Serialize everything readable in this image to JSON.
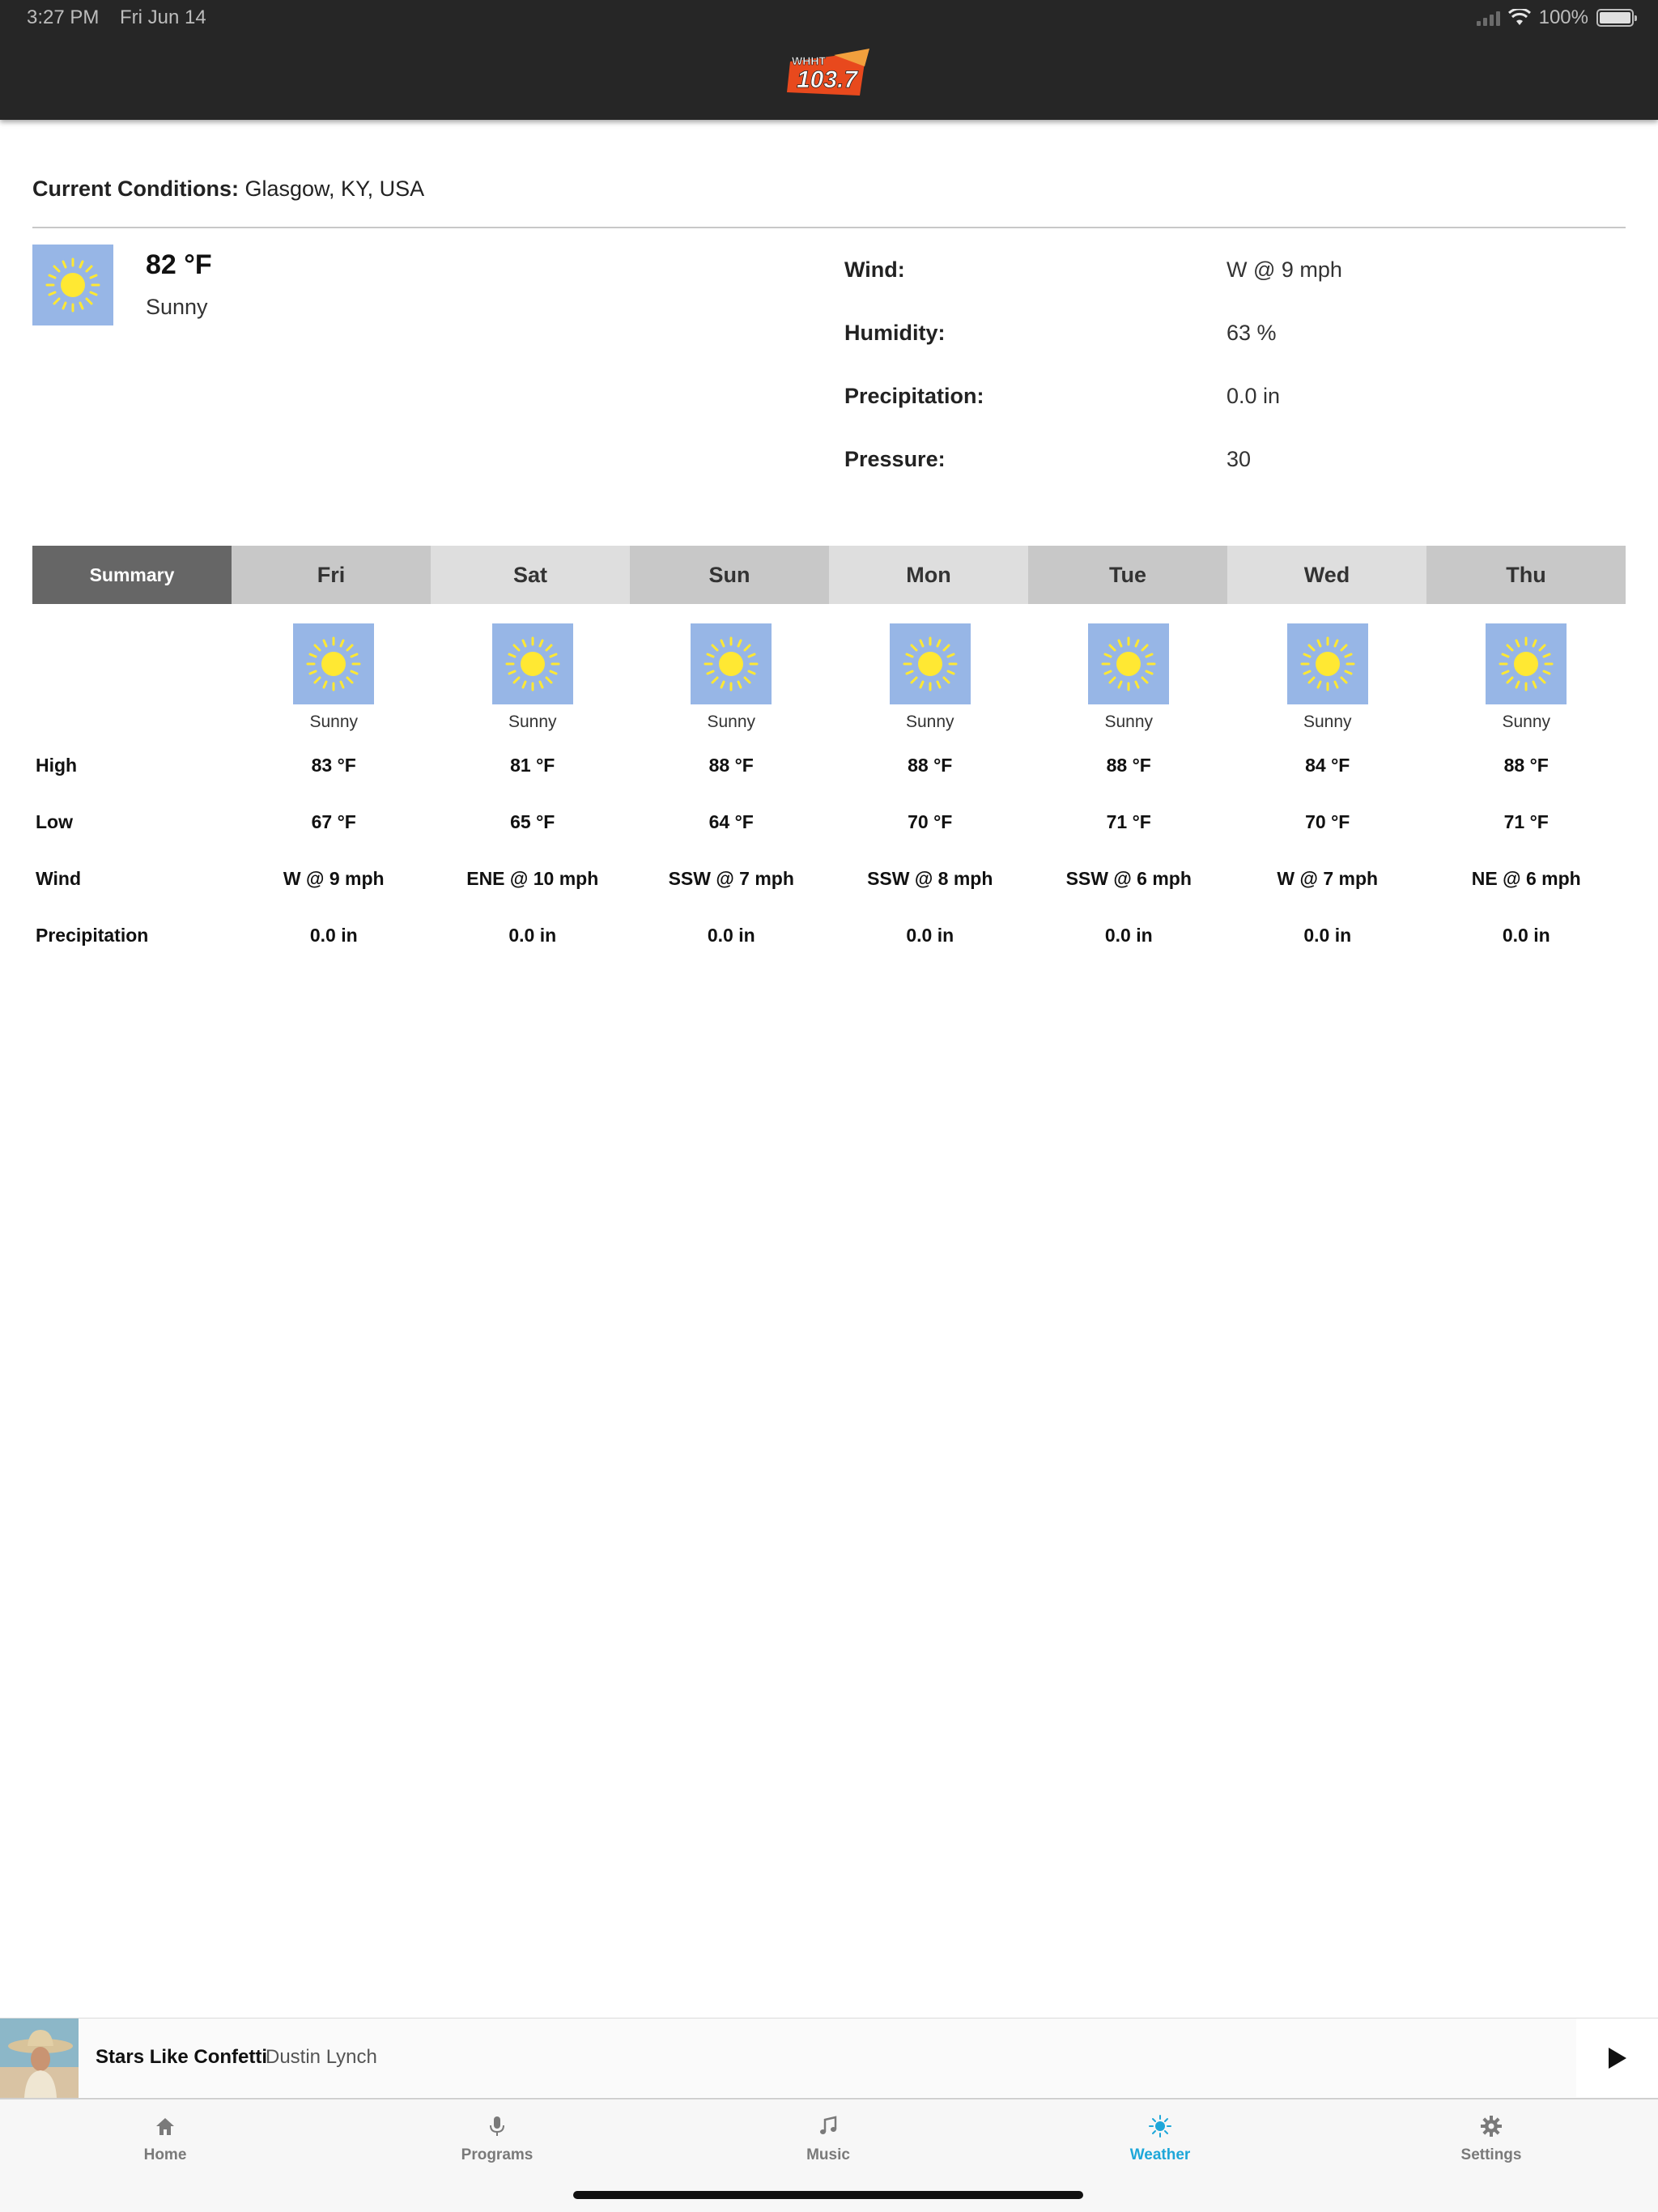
{
  "status_bar": {
    "time": "3:27 PM",
    "date": "Fri Jun 14",
    "battery": "100%"
  },
  "header": {
    "logo_top": "WHHT",
    "logo_main": "103.7"
  },
  "current": {
    "title_label": "Current Conditions:",
    "location": "Glasgow, KY, USA",
    "temp": "82 °F",
    "condition": "Sunny",
    "icon": "sun-icon",
    "details": [
      {
        "label": "Wind:",
        "value": "W @ 9 mph"
      },
      {
        "label": "Humidity:",
        "value": "63 %"
      },
      {
        "label": "Precipitation:",
        "value": "0.0 in"
      },
      {
        "label": "Pressure:",
        "value": "30"
      }
    ]
  },
  "forecast": {
    "summary_tab": "Summary",
    "days": [
      {
        "day": "Fri",
        "condition": "Sunny",
        "high": "83 °F",
        "low": "67 °F",
        "wind": "W @ 9 mph",
        "precip": "0.0 in"
      },
      {
        "day": "Sat",
        "condition": "Sunny",
        "high": "81 °F",
        "low": "65 °F",
        "wind": "ENE @ 10 mph",
        "precip": "0.0 in"
      },
      {
        "day": "Sun",
        "condition": "Sunny",
        "high": "88 °F",
        "low": "64 °F",
        "wind": "SSW @ 7 mph",
        "precip": "0.0 in"
      },
      {
        "day": "Mon",
        "condition": "Sunny",
        "high": "88 °F",
        "low": "70 °F",
        "wind": "SSW @ 8 mph",
        "precip": "0.0 in"
      },
      {
        "day": "Tue",
        "condition": "Sunny",
        "high": "88 °F",
        "low": "71 °F",
        "wind": "SSW @ 6 mph",
        "precip": "0.0 in"
      },
      {
        "day": "Wed",
        "condition": "Sunny",
        "high": "84 °F",
        "low": "70 °F",
        "wind": "W @ 7 mph",
        "precip": "0.0 in"
      },
      {
        "day": "Thu",
        "condition": "Sunny",
        "high": "88 °F",
        "low": "71 °F",
        "wind": "NE @ 6 mph",
        "precip": "0.0 in"
      }
    ],
    "row_labels": {
      "high": "High",
      "low": "Low",
      "wind": "Wind",
      "precip": "Precipitation"
    }
  },
  "now_playing": {
    "title": "Stars Like Confetti",
    "artist": "Dustin Lynch"
  },
  "tab_bar": {
    "items": [
      {
        "label": "Home",
        "icon": "home-icon"
      },
      {
        "label": "Programs",
        "icon": "microphone-icon"
      },
      {
        "label": "Music",
        "icon": "music-note-icon"
      },
      {
        "label": "Weather",
        "icon": "sun-icon",
        "active": true
      },
      {
        "label": "Settings",
        "icon": "gear-icon"
      }
    ]
  },
  "colors": {
    "accent": "#1ea7d9",
    "header_bg": "#262626",
    "summary_tab": "#666666",
    "icon_bg": "#97b6e6",
    "sun": "#ffe833"
  }
}
